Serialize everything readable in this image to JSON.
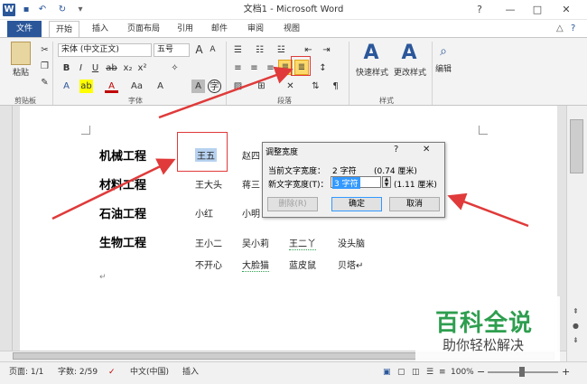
{
  "window": {
    "title": "文档1 - Microsoft Word",
    "help": "?",
    "minimize": "—",
    "restore": "□",
    "close": "✕"
  },
  "tabs": [
    "文件",
    "开始",
    "插入",
    "页面布局",
    "引用",
    "邮件",
    "审阅",
    "视图"
  ],
  "ribbon": {
    "paste_label": "粘贴",
    "font_name": "宋体 (中文正文)",
    "font_size": "五号",
    "quick_styles": "快速样式",
    "change_styles": "更改样式",
    "edit": "编辑",
    "groups": {
      "clipboard": "剪贴板",
      "font": "字体",
      "paragraph": "段落",
      "styles": "样式"
    }
  },
  "document": {
    "rows": [
      {
        "head": "机械工程",
        "names": [
          "王五",
          "赵四",
          "",
          ""
        ]
      },
      {
        "head": "材料工程",
        "names": [
          "王大头",
          "蒋三",
          "",
          ""
        ]
      },
      {
        "head": "石油工程",
        "names": [
          "小红",
          "小明",
          "",
          ""
        ]
      },
      {
        "head": "生物工程",
        "names": [
          "王小二",
          "吴小莉",
          "王二丫",
          "没头脑"
        ]
      },
      {
        "head": "",
        "names": [
          "不开心",
          "大脸猫",
          "蓝皮鼠",
          "贝塔↵"
        ]
      }
    ],
    "end_mark": "↵"
  },
  "dialog": {
    "title": "调整宽度",
    "help": "?",
    "close": "✕",
    "current_label": "当前文字宽度：",
    "current_value": "2 字符",
    "current_cm": "(0.74 厘米)",
    "new_label": "新文字宽度(T)：",
    "new_value": "3 字符",
    "new_cm": "(1.11 厘米)",
    "delete_button": "删除(R)",
    "ok_button": "确定",
    "cancel_button": "取消"
  },
  "status": {
    "page": "页面: 1/1",
    "words": "字数: 2/59",
    "language": "中文(中国)",
    "mode": "插入",
    "zoom": "100%",
    "zoom_minus": "−",
    "zoom_plus": "+"
  },
  "watermark": {
    "title": "百科全说",
    "subtitle": "助你轻松解决"
  },
  "colors": {
    "accent": "#2b579a",
    "annotation": "#e03a3a",
    "watermark": "#2e9e4f"
  }
}
